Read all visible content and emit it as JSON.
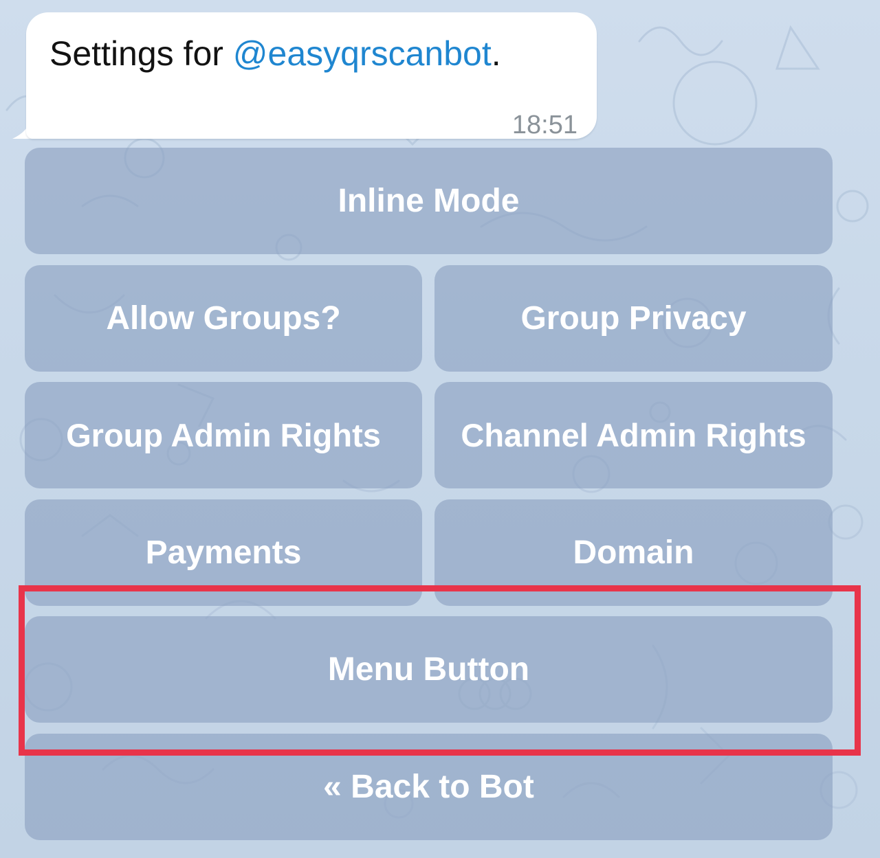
{
  "colors": {
    "chat_background": "#c8d8e9",
    "bubble_background": "#ffffff",
    "mention_link": "#1f86d0",
    "keyboard_button": "#8aa0c0",
    "keyboard_text": "#ffffff",
    "highlight": "#e8344a"
  },
  "message": {
    "prefix": "Settings for ",
    "mention": "@easyqrscanbot",
    "suffix": ".",
    "time": "18:51"
  },
  "keyboard": {
    "inline_mode": "Inline Mode",
    "allow_groups": "Allow Groups?",
    "group_privacy": "Group Privacy",
    "group_admin_rights": "Group Admin Rights",
    "channel_admin_rights": "Channel Admin Rights",
    "payments": "Payments",
    "domain": "Domain",
    "menu_button": "Menu Button",
    "back_to_bot": "« Back to Bot"
  },
  "highlight": {
    "target": "menu-button"
  }
}
